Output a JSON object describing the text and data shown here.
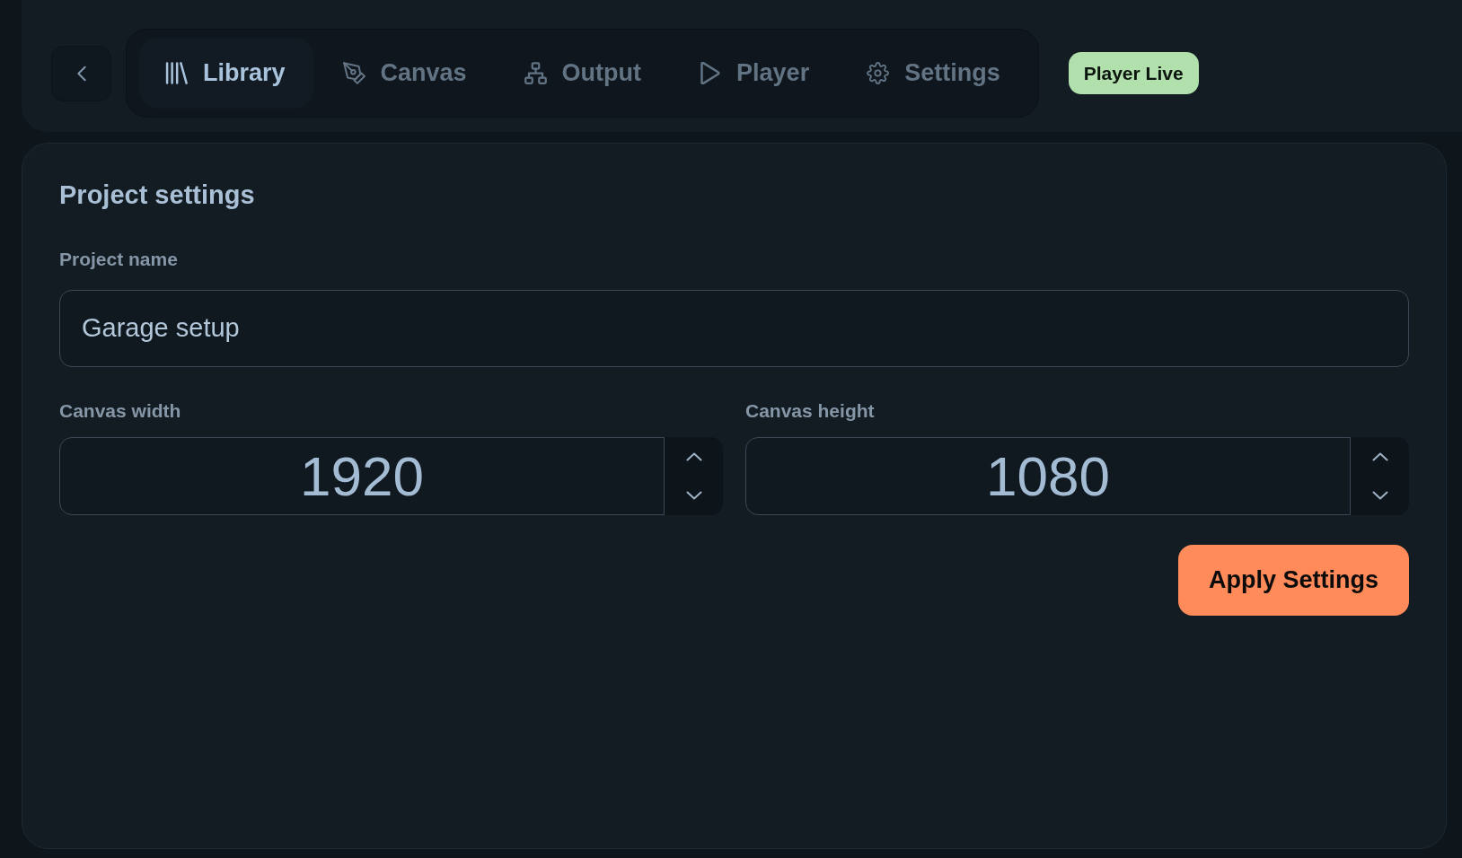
{
  "tabs": [
    {
      "label": "Library",
      "selected": true
    },
    {
      "label": "Canvas",
      "selected": false
    },
    {
      "label": "Output",
      "selected": false
    },
    {
      "label": "Player",
      "selected": false
    },
    {
      "label": "Settings",
      "selected": false
    }
  ],
  "status_badge": {
    "label": "Player Live"
  },
  "settings_card": {
    "title": "Project settings",
    "fields": [
      {
        "kind": "text",
        "label": "Project name",
        "value": "Garage setup"
      },
      {
        "kind": "number",
        "label": "Canvas width",
        "value": "1920"
      },
      {
        "kind": "number",
        "label": "Canvas height",
        "value": "1080"
      }
    ],
    "apply_button": {
      "label": "Apply Settings"
    }
  }
}
